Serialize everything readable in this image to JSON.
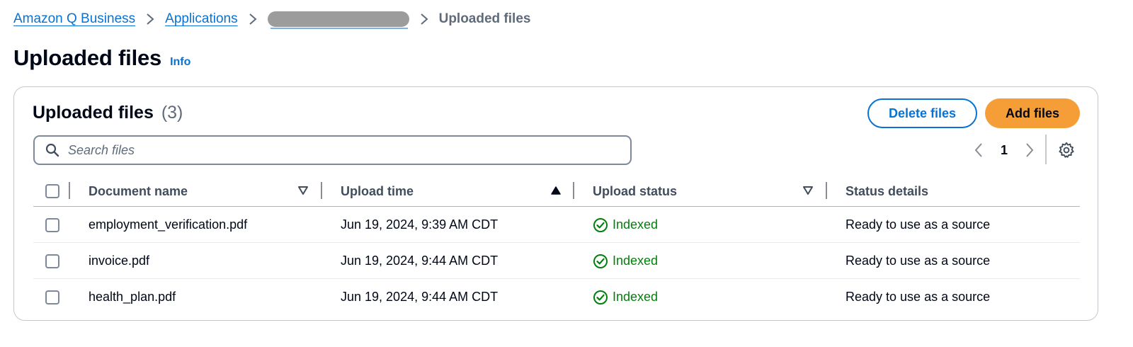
{
  "breadcrumb": {
    "items": [
      "Amazon Q Business",
      "Applications"
    ],
    "current": "Uploaded files"
  },
  "page": {
    "title": "Uploaded files",
    "info_label": "Info"
  },
  "panel": {
    "title": "Uploaded files",
    "count": "(3)",
    "delete_label": "Delete files",
    "add_label": "Add files",
    "search_placeholder": "Search files",
    "current_page": "1"
  },
  "table": {
    "columns": [
      "Document name",
      "Upload time",
      "Upload status",
      "Status details"
    ],
    "sorted_column": "Upload time",
    "rows": [
      {
        "name": "employment_verification.pdf",
        "time": "Jun 19, 2024, 9:39 AM CDT",
        "status": "Indexed",
        "details": "Ready to use as a source"
      },
      {
        "name": "invoice.pdf",
        "time": "Jun 19, 2024, 9:44 AM CDT",
        "status": "Indexed",
        "details": "Ready to use as a source"
      },
      {
        "name": "health_plan.pdf",
        "time": "Jun 19, 2024, 9:44 AM CDT",
        "status": "Indexed",
        "details": "Ready to use as a source"
      }
    ]
  },
  "colors": {
    "link": "#0972d3",
    "primary_button": "#f59e38",
    "success": "#037f0c",
    "muted_text": "#5f6b7a"
  },
  "icons": [
    "chevron-right-icon",
    "search-icon",
    "chevron-left-icon",
    "gear-icon",
    "sort-triangle-icon",
    "check-circle-icon"
  ]
}
